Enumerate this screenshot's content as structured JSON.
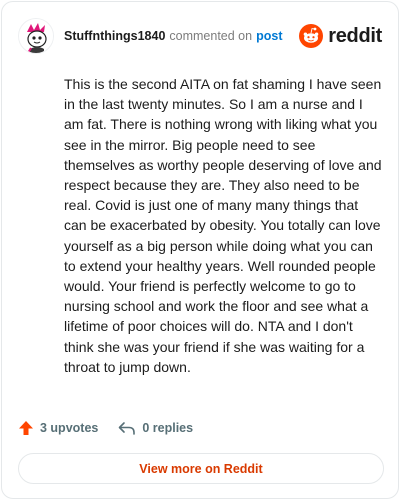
{
  "header": {
    "username": "Stuffnthings1840",
    "action_text": "commented on",
    "post_link": "post",
    "brand_word": "reddit"
  },
  "comment": {
    "text": "This is the second AITA on fat shaming I have seen in the last twenty minutes. So I am a nurse and I am fat. There is nothing wrong with liking what you see in the mirror. Big people need to see themselves as worthy people deserving of love and respect because they are. They also need to be real. Covid is just one of many many things that can be exacerbated by obesity. You totally can love yourself as a big person while doing what you can to extend your healthy years. Well rounded people would. Your friend is perfectly welcome to go to nursing school and work the floor and see what a lifetime of poor choices will do. NTA and I don't think she was your friend if she was waiting for a throat to jump down."
  },
  "actions": {
    "upvotes_label": "3 upvotes",
    "replies_label": "0 replies"
  },
  "footer": {
    "view_more_label": "View more on Reddit"
  },
  "colors": {
    "accent": "#d93a00",
    "link": "#0079d3",
    "upvote": "#ff4500",
    "muted": "#576f76"
  },
  "icons": [
    "snoo-avatar-icon",
    "reddit-logo-icon",
    "upvote-arrow-icon",
    "reply-arrow-icon"
  ]
}
